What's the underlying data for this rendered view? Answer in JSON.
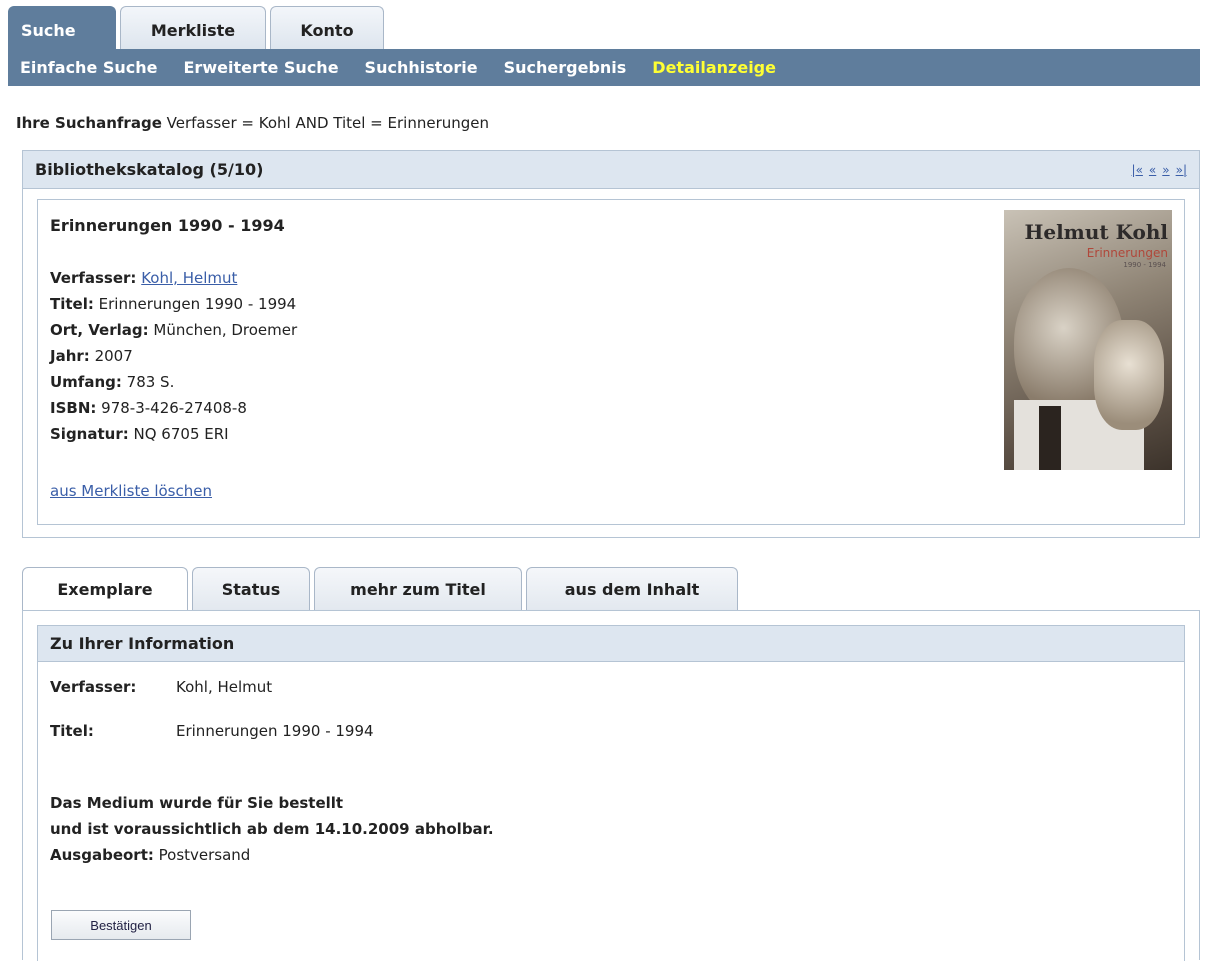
{
  "top_tabs": [
    {
      "label": "Suche",
      "active": true
    },
    {
      "label": "Merkliste",
      "active": false
    },
    {
      "label": "Konto",
      "active": false
    }
  ],
  "subnav": {
    "items": [
      "Einfache Suche",
      "Erweiterte Suche",
      "Suchhistorie",
      "Suchergebnis",
      "Detailanzeige"
    ],
    "current_index": 4
  },
  "query": {
    "label": "Ihre Suchanfrage",
    "text": "Verfasser = Kohl AND Titel = Erinnerungen"
  },
  "catalog": {
    "title": "Bibliothekskatalog (5/10)",
    "pager": [
      "|«",
      "«",
      "»",
      "»|"
    ]
  },
  "record": {
    "title": "Erinnerungen 1990 - 1994",
    "fields": {
      "verfasser_label": "Verfasser:",
      "verfasser_value": "Kohl, Helmut",
      "titel_label": "Titel:",
      "titel_value": "Erinnerungen 1990 - 1994",
      "ort_label": "Ort, Verlag:",
      "ort_value": "München, Droemer",
      "jahr_label": "Jahr:",
      "jahr_value": "2007",
      "umfang_label": "Umfang:",
      "umfang_value": "783 S.",
      "isbn_label": "ISBN:",
      "isbn_value": "978-3-426-27408-8",
      "signatur_label": "Signatur:",
      "signatur_value": "NQ 6705 ERI"
    },
    "remove_link": "aus Merkliste löschen",
    "cover": {
      "author": "Helmut Kohl",
      "title": "Erinnerungen",
      "years": "1990 - 1994"
    }
  },
  "lower_tabs": [
    "Exemplare",
    "Status",
    "mehr zum Titel",
    "aus dem Inhalt"
  ],
  "info": {
    "header": "Zu Ihrer Information",
    "verfasser_label": "Verfasser:",
    "verfasser_value": "Kohl, Helmut",
    "titel_label": "Titel:",
    "titel_value": "Erinnerungen 1990 - 1994",
    "notice_line1": "Das Medium wurde für Sie bestellt",
    "notice_line2": "und ist voraussichtlich ab dem 14.10.2009 abholbar.",
    "ausgabeort_label": "Ausgabeort:",
    "ausgabeort_value": "Postversand",
    "confirm_label": "Bestätigen"
  },
  "colors": {
    "nav_bg": "#5f7d9c",
    "active_subnav": "#ffff33",
    "panel_header": "#dde6f0",
    "link": "#3a5ea8"
  }
}
